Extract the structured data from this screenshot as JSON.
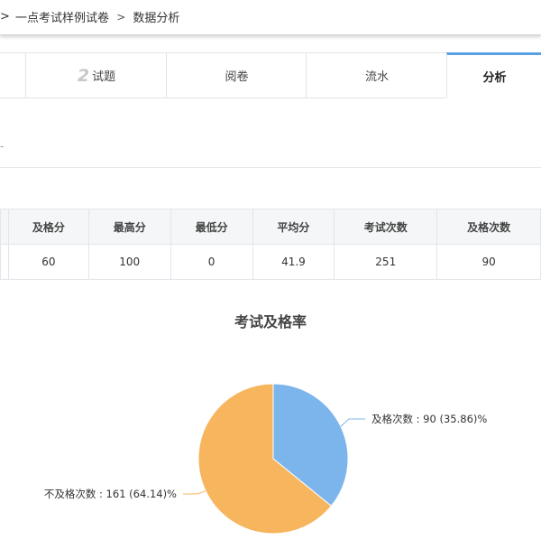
{
  "breadcrumb": {
    "lead_arrow": ">",
    "items": [
      "一点考试样例试卷",
      "数据分析"
    ],
    "separator": ">"
  },
  "tabs": [
    {
      "number": "",
      "label": ""
    },
    {
      "number": "2",
      "label": "试题"
    },
    {
      "number": "",
      "label": "阅卷"
    },
    {
      "number": "",
      "label": "流水"
    },
    {
      "number": "",
      "label": "分析"
    }
  ],
  "active_tab": 4,
  "subtitle_fragment": "-",
  "stats_table": {
    "headers": [
      "",
      "及格分",
      "最高分",
      "最低分",
      "平均分",
      "考试次数",
      "及格次数"
    ],
    "row": [
      "",
      "60",
      "100",
      "0",
      "41.9",
      "251",
      "90"
    ]
  },
  "chart_data": {
    "type": "pie",
    "title": "考试及格率",
    "slices": [
      {
        "name": "及格次数",
        "value": 90,
        "percent": 35.86,
        "label": "及格次数 : 90 (35.86)%",
        "color": "#7cb5ec"
      },
      {
        "name": "不及格次数",
        "value": 161,
        "percent": 64.14,
        "label": "不及格次数 : 161 (64.14)%",
        "color": "#f7b55e"
      }
    ]
  }
}
